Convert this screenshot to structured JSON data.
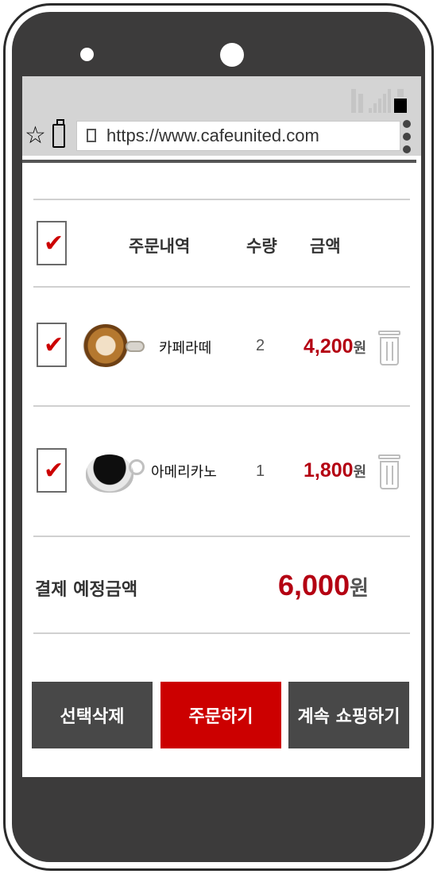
{
  "browser": {
    "url": "https://www.cafeunited.com",
    "icons": [
      "star-icon",
      "bookmark-icon",
      "page-icon",
      "menu-icon"
    ]
  },
  "status_bar": {
    "icons": [
      "data-arrows-icon",
      "signal-icon",
      "battery-icon"
    ]
  },
  "cart": {
    "header": {
      "order_details": "주문내역",
      "quantity": "수량",
      "amount": "금액"
    },
    "items": [
      {
        "name": "카페라떼",
        "qty": "2",
        "price": "4,200",
        "unit": "원",
        "checked": true,
        "icon": "latte-icon"
      },
      {
        "name": "아메리카노",
        "qty": "1",
        "price": "1,800",
        "unit": "원",
        "checked": true,
        "icon": "americano-icon"
      }
    ],
    "total": {
      "label": "결제 예정금액",
      "amount": "6,000",
      "unit": "원"
    }
  },
  "buttons": {
    "delete_selected": "선택삭제",
    "order": "주문하기",
    "continue_shopping": "계속 쇼핑하기"
  },
  "colors": {
    "accent": "#cc0000",
    "price": "#b40012",
    "button_dark": "#484848",
    "phone_body": "#3c3b3b"
  }
}
